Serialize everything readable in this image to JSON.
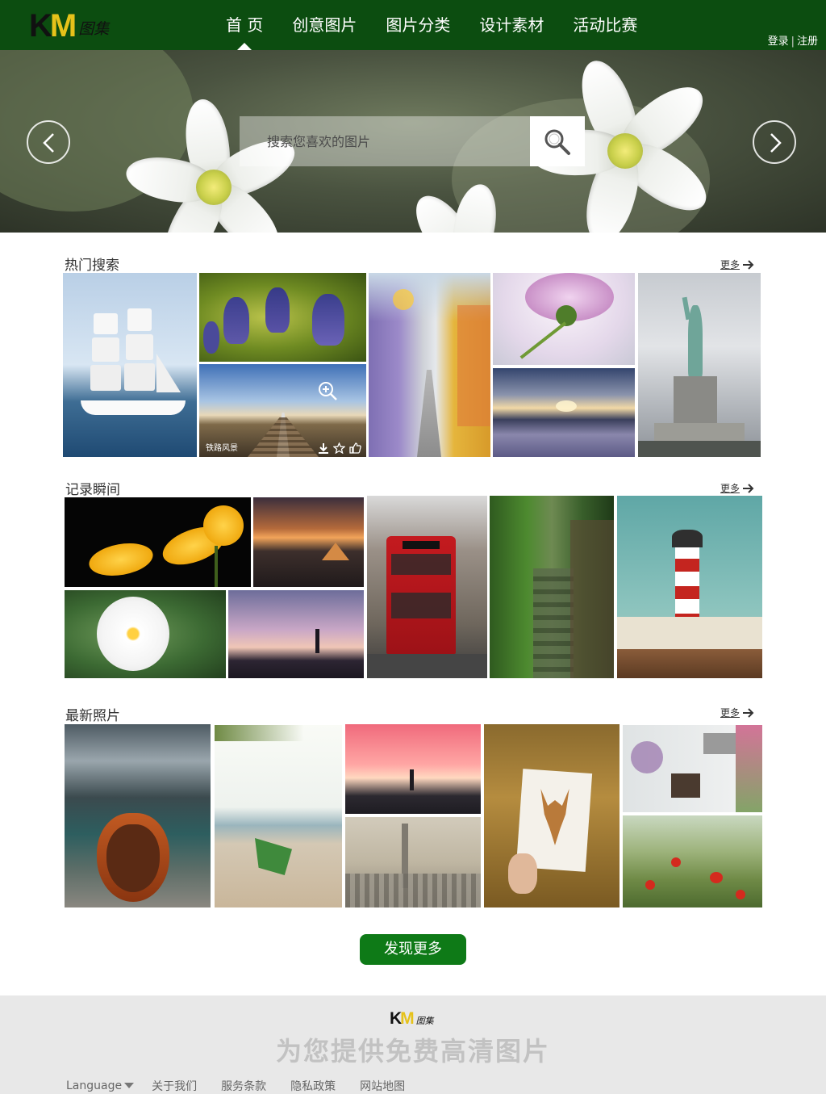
{
  "header": {
    "logo": {
      "k": "K",
      "m": "M",
      "tail": "图集"
    },
    "nav": [
      "首 页",
      "创意图片",
      "图片分类",
      "设计素材",
      "活动比赛"
    ],
    "login": "登录",
    "register": "注册"
  },
  "banner": {
    "search_placeholder": "搜索您喜欢的图片"
  },
  "sections": {
    "hot": {
      "title": "热门搜索",
      "more": "更多"
    },
    "moments": {
      "title": "记录瞬间",
      "more": "更多"
    },
    "latest": {
      "title": "最新照片",
      "more": "更多"
    }
  },
  "hover_caption": "铁路风景",
  "discover_button": "发现更多",
  "footer": {
    "logo": {
      "k": "K",
      "m": "M",
      "tail": "图集"
    },
    "slogan": "为您提供免费高清图片",
    "language": "Language",
    "links": [
      "关于我们",
      "服务条款",
      "隐私政策",
      "网站地图"
    ]
  },
  "colors": {
    "header_green": "#0c4d10",
    "button_green": "#0e7a17",
    "logo_yellow": "#e6c21a",
    "footer_bg": "#e8e8e8"
  },
  "icons": [
    "chevron-left-icon",
    "chevron-right-icon",
    "search-icon",
    "arrow-right-icon",
    "zoom-icon",
    "download-icon",
    "star-icon",
    "thumbs-up-icon",
    "caret-down-icon"
  ]
}
